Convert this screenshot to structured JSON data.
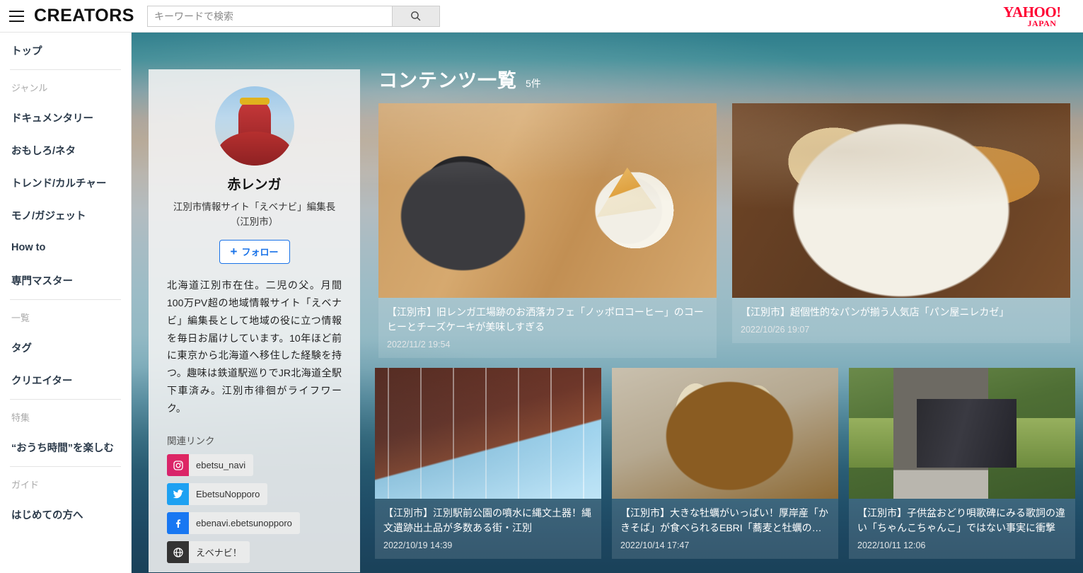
{
  "header": {
    "brand": "CREATORS",
    "menu_icon": "hamburger-icon",
    "search_placeholder": "キーワードで検索",
    "search_value": "",
    "search_icon": "search-icon",
    "logo_line1": "YAHOO!",
    "logo_line2": "JAPAN"
  },
  "sidebar": {
    "top": {
      "label": "トップ"
    },
    "sections": [
      {
        "heading": "ジャンル",
        "items": [
          {
            "label": "ドキュメンタリー"
          },
          {
            "label": "おもしろ/ネタ"
          },
          {
            "label": "トレンド/カルチャー"
          },
          {
            "label": "モノ/ガジェット"
          },
          {
            "label": "How to"
          },
          {
            "label": "専門マスター"
          }
        ]
      },
      {
        "heading": "一覧",
        "items": [
          {
            "label": "タグ"
          },
          {
            "label": "クリエイター"
          }
        ]
      },
      {
        "heading": "特集",
        "items": [
          {
            "label": "“おうち時間”を楽しむ"
          }
        ]
      },
      {
        "heading": "ガイド",
        "items": [
          {
            "label": "はじめての方へ"
          }
        ]
      }
    ]
  },
  "profile": {
    "avatar_alt": "赤レンガ",
    "name": "赤レンガ",
    "role": "江別市情報サイト「えベナビ」編集長（江別市）",
    "follow_label": "フォロー",
    "follow_icon": "plus-icon",
    "bio": "北海道江別市在住。二児の父。月間100万PV超の地域情報サイト「えベナビ」編集長として地域の役に立つ情報を毎日お届けしています。10年ほど前に東京から北海道へ移住した経験を持つ。趣味は鉄道駅巡りでJR北海道全駅下車済み。江別市徘徊がライフワーク。",
    "links_heading": "関連リンク",
    "links": [
      {
        "icon": "instagram-icon",
        "label": "ebetsu_navi",
        "color": "#d6246e"
      },
      {
        "icon": "twitter-icon",
        "label": "EbetsuNopporo",
        "color": "#1da1f2"
      },
      {
        "icon": "facebook-icon",
        "label": "ebenavi.ebetsunopporo",
        "color": "#1877f2"
      },
      {
        "icon": "globe-icon",
        "label": "えベナビ！",
        "color": "#333333"
      }
    ]
  },
  "content": {
    "title": "コンテンツ一覧",
    "count": "5件",
    "cards": [
      {
        "title": "【江別市】旧レンガ工場跡のお洒落カフェ「ノッポロコーヒー」のコーヒーとチーズケーキが美味しすぎる",
        "date": "2022/11/2 19:54",
        "thumb": "coffee-and-cheesecake-photo"
      },
      {
        "title": "【江別市】超個性的なパンが揃う人気店「パン屋ニレカゼ」",
        "date": "2022/10/26 19:07",
        "thumb": "assorted-bread-plate-photo"
      },
      {
        "title": "【江別市】江別駅前公園の噴水に縄文土器！縄文遺跡出土品が多数ある街・江別",
        "date": "2022/10/19 14:39",
        "thumb": "brick-fountain-photo"
      },
      {
        "title": "【江別市】大きな牡蠣がいっぱい！厚岸産「かきそば」が食べられるEBRI「蕎麦と牡蠣の…",
        "date": "2022/10/14 17:47",
        "thumb": "oyster-soba-photo"
      },
      {
        "title": "【江別市】子供盆おどり唄歌碑にみる歌詞の違い「ちゃんこちゃんこ」ではない事実に衝撃",
        "date": "2022/10/11 12:06",
        "thumb": "stone-monument-photo"
      }
    ]
  },
  "colors": {
    "accent_blue": "#1a73e8",
    "yahoo_red": "#ff0033",
    "sidebar_text": "#2b3a4a",
    "heading_gray": "#aaaaaa"
  }
}
